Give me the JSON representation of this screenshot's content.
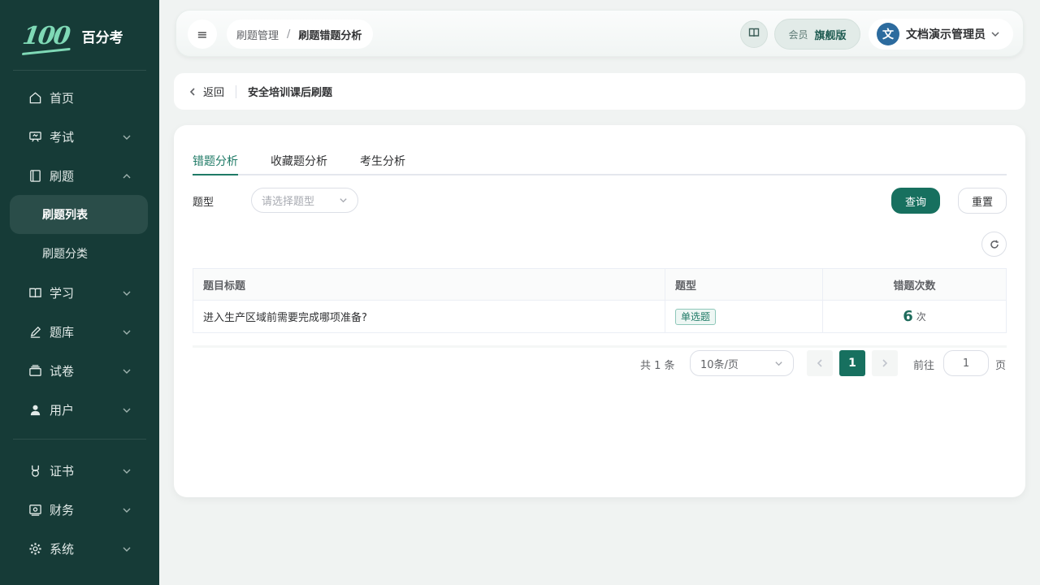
{
  "brand": {
    "logo_text": "100",
    "name": "百分考"
  },
  "sidebar": {
    "items": [
      {
        "label": "首页",
        "icon": "home-icon"
      },
      {
        "label": "考试",
        "icon": "exam-board-icon"
      },
      {
        "label": "刷题",
        "icon": "practice-book-icon"
      },
      {
        "label": "刷题列表",
        "active": true
      },
      {
        "label": "刷题分类"
      },
      {
        "label": "学习",
        "icon": "open-book-icon"
      },
      {
        "label": "题库",
        "icon": "pen-icon"
      },
      {
        "label": "试卷",
        "icon": "paper-stack-icon"
      },
      {
        "label": "用户",
        "icon": "user-icon"
      },
      {
        "label": "证书",
        "icon": "medal-icon"
      },
      {
        "label": "财务",
        "icon": "wallet-icon"
      },
      {
        "label": "系统",
        "icon": "gear-icon"
      }
    ]
  },
  "header": {
    "breadcrumb": [
      "刷题管理",
      "刷题错题分析"
    ],
    "breadcrumb_sep": "/",
    "member_label": "会员",
    "member_plan": "旗舰版",
    "user_avatar": "文",
    "user_name": "文档演示管理员"
  },
  "backbar": {
    "back_label": "返回",
    "title": "安全培训课后刷题"
  },
  "tabs": [
    "错题分析",
    "收藏题分析",
    "考生分析"
  ],
  "filter": {
    "label": "题型",
    "placeholder": "请选择题型",
    "search_button": "查询",
    "reset_button": "重置"
  },
  "table": {
    "columns": [
      "题目标题",
      "题型",
      "错题次数"
    ],
    "rows": [
      {
        "title": "进入生产区域前需要完成哪项准备?",
        "type": "单选题",
        "count": "6",
        "unit": "次"
      }
    ]
  },
  "pagination": {
    "total": "共 1 条",
    "page_size": "10条/页",
    "current_page": "1",
    "goto_label": "前往",
    "goto_value": "1",
    "goto_unit": "页"
  },
  "colors": {
    "sidebar_bg": "#163b37",
    "primary": "#17705f",
    "accent": "#1f7a66"
  }
}
